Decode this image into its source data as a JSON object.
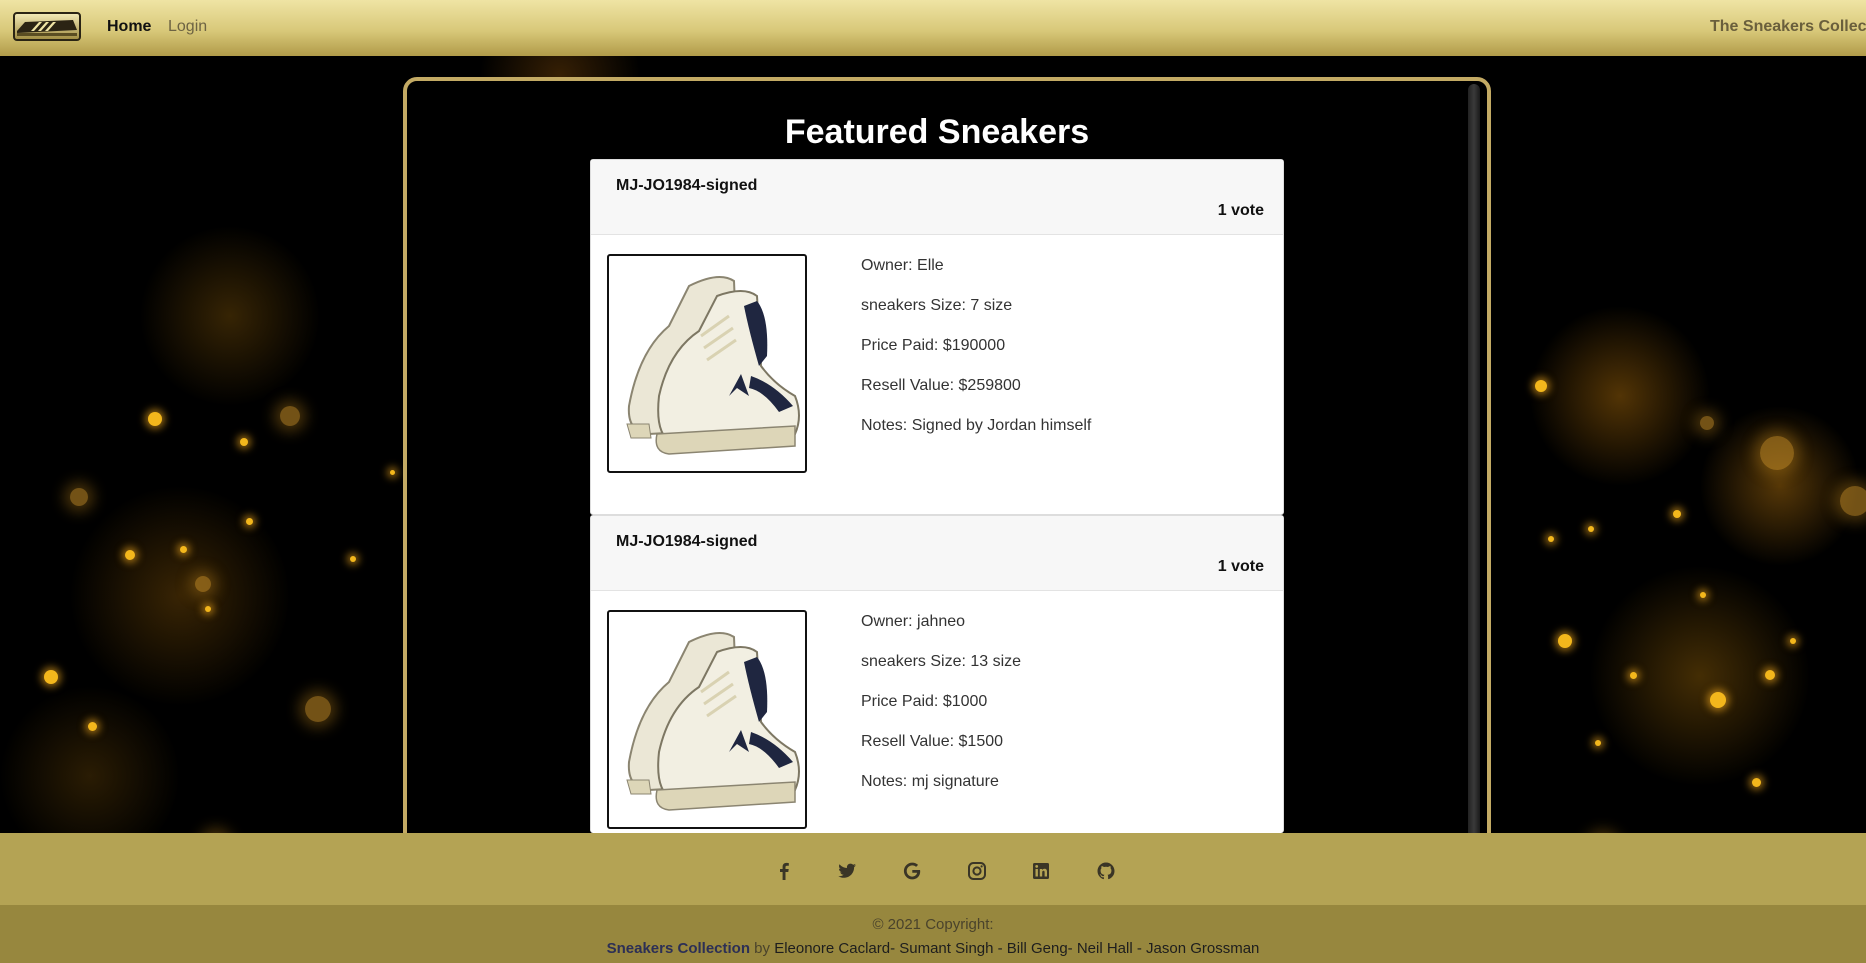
{
  "navbar": {
    "logo_icon": "sneaker-logo-icon",
    "home_label": "Home",
    "login_label": "Login",
    "brand_text": "The Sneakers Collect"
  },
  "main": {
    "title": "Featured Sneakers",
    "cards": [
      {
        "name": "MJ-JO1984-signed",
        "votes": "1 vote",
        "owner": "Owner: Elle",
        "size": "sneakers Size: 7 size",
        "price": "Price Paid: $190000",
        "resell": "Resell Value: $259800",
        "notes": "Notes: Signed by Jordan himself"
      },
      {
        "name": "MJ-JO1984-signed",
        "votes": "1 vote",
        "owner": "Owner: jahneo",
        "size": "sneakers Size: 13 size",
        "price": "Price Paid: $1000",
        "resell": "Resell Value: $1500",
        "notes": "Notes: mj signature"
      }
    ]
  },
  "footer": {
    "social_icons": [
      "facebook-icon",
      "twitter-icon",
      "google-icon",
      "instagram-icon",
      "linkedin-icon",
      "github-icon"
    ],
    "copyright": "© 2021 Copyright:",
    "site_name": "Sneakers Collection",
    "by_text": "by",
    "authors": "Eleonore Caclard- Sumant Singh - Bill Geng- Neil Hall - Jason Grossman"
  },
  "colors": {
    "navbar_gold": "#d8c879",
    "frame_border": "#c3aa64",
    "footer_top": "#b4a354",
    "footer_bottom": "#97873e"
  }
}
